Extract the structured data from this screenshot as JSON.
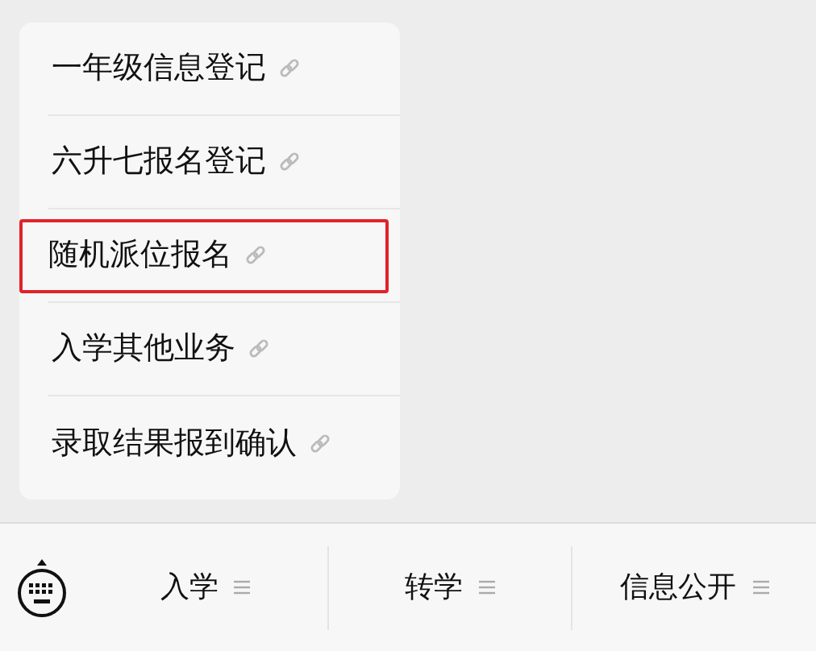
{
  "menu": {
    "items": [
      {
        "label": "一年级信息登记",
        "highlighted": false
      },
      {
        "label": "六升七报名登记",
        "highlighted": false
      },
      {
        "label": "随机派位报名",
        "highlighted": true
      },
      {
        "label": "入学其他业务",
        "highlighted": false
      },
      {
        "label": "录取结果报到确认",
        "highlighted": false
      }
    ]
  },
  "bottom_bar": {
    "tabs": [
      {
        "label": "入学"
      },
      {
        "label": "转学"
      },
      {
        "label": "信息公开"
      }
    ]
  }
}
